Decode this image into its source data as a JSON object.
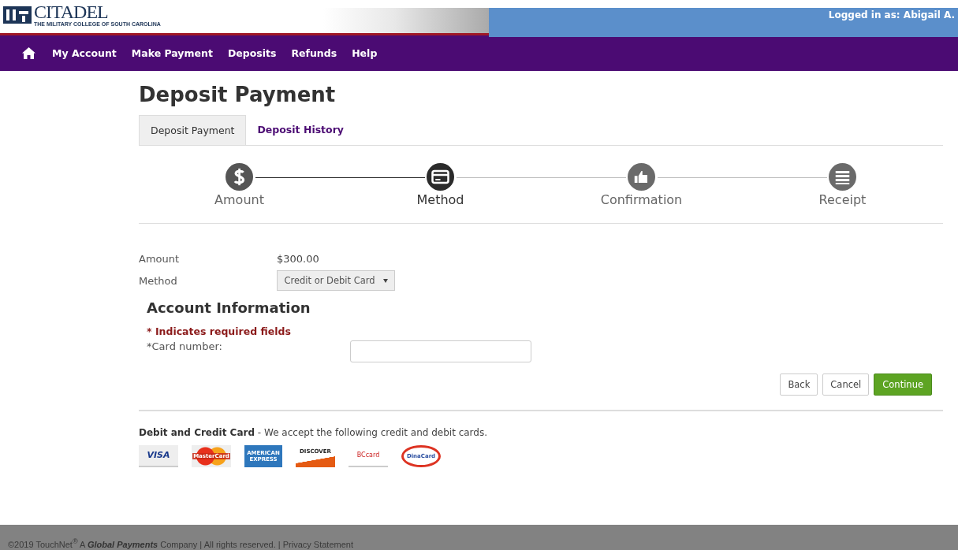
{
  "header": {
    "logo": {
      "name": "CITADEL",
      "subtitle": "THE MILITARY COLLEGE OF SOUTH CAROLINA"
    },
    "user": "Logged in as: Abigail A."
  },
  "nav": {
    "items": [
      "My Account",
      "Make Payment",
      "Deposits",
      "Refunds",
      "Help"
    ]
  },
  "page_title": "Deposit Payment",
  "tabs": [
    {
      "label": "Deposit Payment",
      "selected": true
    },
    {
      "label": "Deposit History",
      "selected": false
    }
  ],
  "steps": [
    {
      "label": "Amount",
      "kind": "dollar",
      "completed": true,
      "selected": false
    },
    {
      "label": "Method",
      "kind": "card",
      "completed": false,
      "selected": true
    },
    {
      "label": "Confirmation",
      "kind": "thumb",
      "completed": false,
      "selected": false
    },
    {
      "label": "Receipt",
      "kind": "list",
      "completed": false,
      "selected": false
    }
  ],
  "summary": [
    {
      "label": "Amount",
      "kind": "text",
      "value": "$300.00"
    },
    {
      "label": "Method",
      "kind": "select",
      "value": "Credit or Debit Card"
    }
  ],
  "account_info": {
    "title": "Account Information",
    "required_note": "* Indicates required fields",
    "fields": [
      {
        "label": "*Card number:"
      }
    ]
  },
  "buttons": [
    {
      "label": "Back",
      "kind": "default"
    },
    {
      "label": "Cancel",
      "kind": "default"
    },
    {
      "label": "Continue",
      "kind": "primary"
    }
  ],
  "cards_section": {
    "title": "Debit and Credit Card",
    "text": " - We accept the following credit and debit cards.",
    "cards": [
      {
        "kind": "visa",
        "text": "VISA"
      },
      {
        "kind": "mastercard",
        "text": "MasterCard"
      },
      {
        "kind": "amex",
        "text": "AMERICAN EXPRESS"
      },
      {
        "kind": "discover",
        "text": "DISCOVER"
      },
      {
        "kind": "bccard",
        "text": "BCcard"
      },
      {
        "kind": "dinacard",
        "text": "DinaCard"
      }
    ]
  },
  "footer": {
    "text": "©2019 TouchNet$^{®}$ A **Global Payments** Company | All rights reserved. | ",
    "link": "Privacy Statement"
  }
}
